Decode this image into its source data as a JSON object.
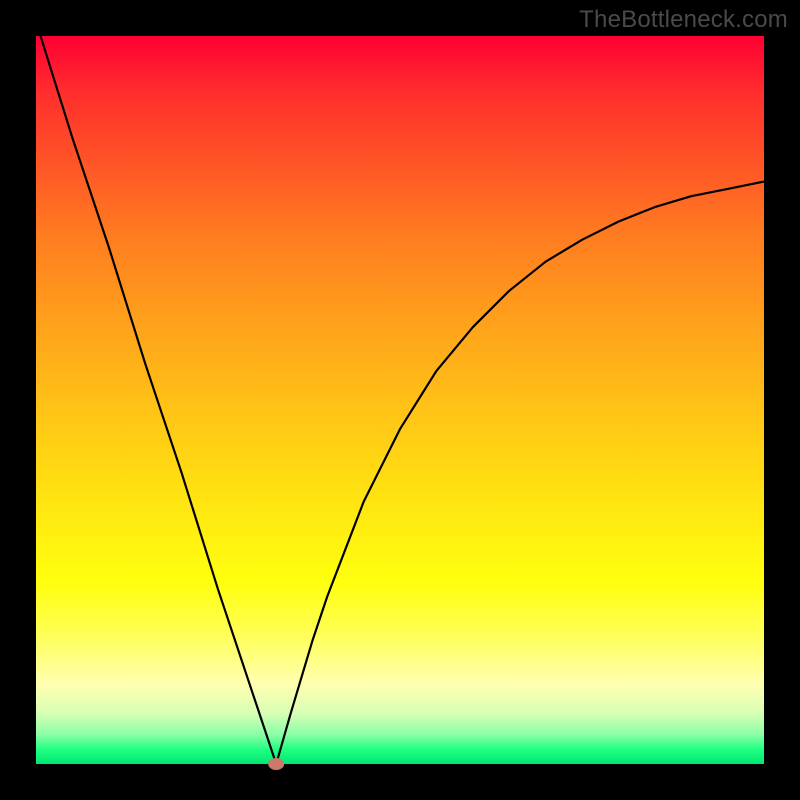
{
  "watermark": "TheBottleneck.com",
  "chart_data": {
    "type": "line",
    "title": "",
    "xlabel": "",
    "ylabel": "",
    "xlim": [
      0,
      100
    ],
    "ylim": [
      0,
      100
    ],
    "grid": false,
    "legend": false,
    "marker": {
      "x": 33,
      "y": 0,
      "color": "#c97a6b"
    },
    "series": [
      {
        "name": "curve",
        "x": [
          0,
          5,
          10,
          15,
          20,
          25,
          30,
          33,
          35,
          38,
          40,
          45,
          50,
          55,
          60,
          65,
          70,
          75,
          80,
          85,
          90,
          95,
          100
        ],
        "y": [
          102,
          86,
          71,
          55,
          40,
          24,
          9,
          0,
          7,
          17,
          23,
          36,
          46,
          54,
          60,
          65,
          69,
          72,
          74.5,
          76.5,
          78,
          79,
          80
        ]
      }
    ],
    "gradient_stops": [
      {
        "pct": 0,
        "color": "#ff0033"
      },
      {
        "pct": 18,
        "color": "#ff5726"
      },
      {
        "pct": 40,
        "color": "#ffa31b"
      },
      {
        "pct": 64,
        "color": "#ffe511"
      },
      {
        "pct": 82,
        "color": "#ffff55"
      },
      {
        "pct": 93,
        "color": "#d8ffb5"
      },
      {
        "pct": 100,
        "color": "#00e676"
      }
    ]
  }
}
